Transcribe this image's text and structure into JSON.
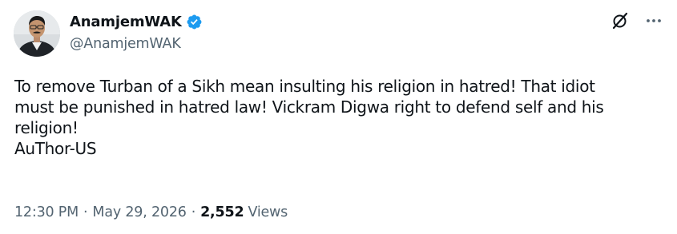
{
  "author": {
    "display_name": "AnamjemWAK",
    "handle": "@AnamjemWAK",
    "verified": true
  },
  "icons": {
    "avatar": "profile-photo",
    "verified": "verified-badge-icon",
    "grok": "grok-icon",
    "more": "more-icon"
  },
  "colors": {
    "verified_blue": "#1d9bf0",
    "secondary_text": "#536471",
    "primary_text": "#0f1419"
  },
  "tweet": {
    "text": "To remove Turban of a Sikh mean insulting his religion in hatred! That idiot\nmust be punished in hatred law! Vickram Digwa right to defend self and his\nreligion!\nAuThor-US"
  },
  "meta": {
    "time": "12:30 PM",
    "separator": "·",
    "date": "May 29, 2026",
    "views_count": "2,552",
    "views_label": "Views"
  }
}
